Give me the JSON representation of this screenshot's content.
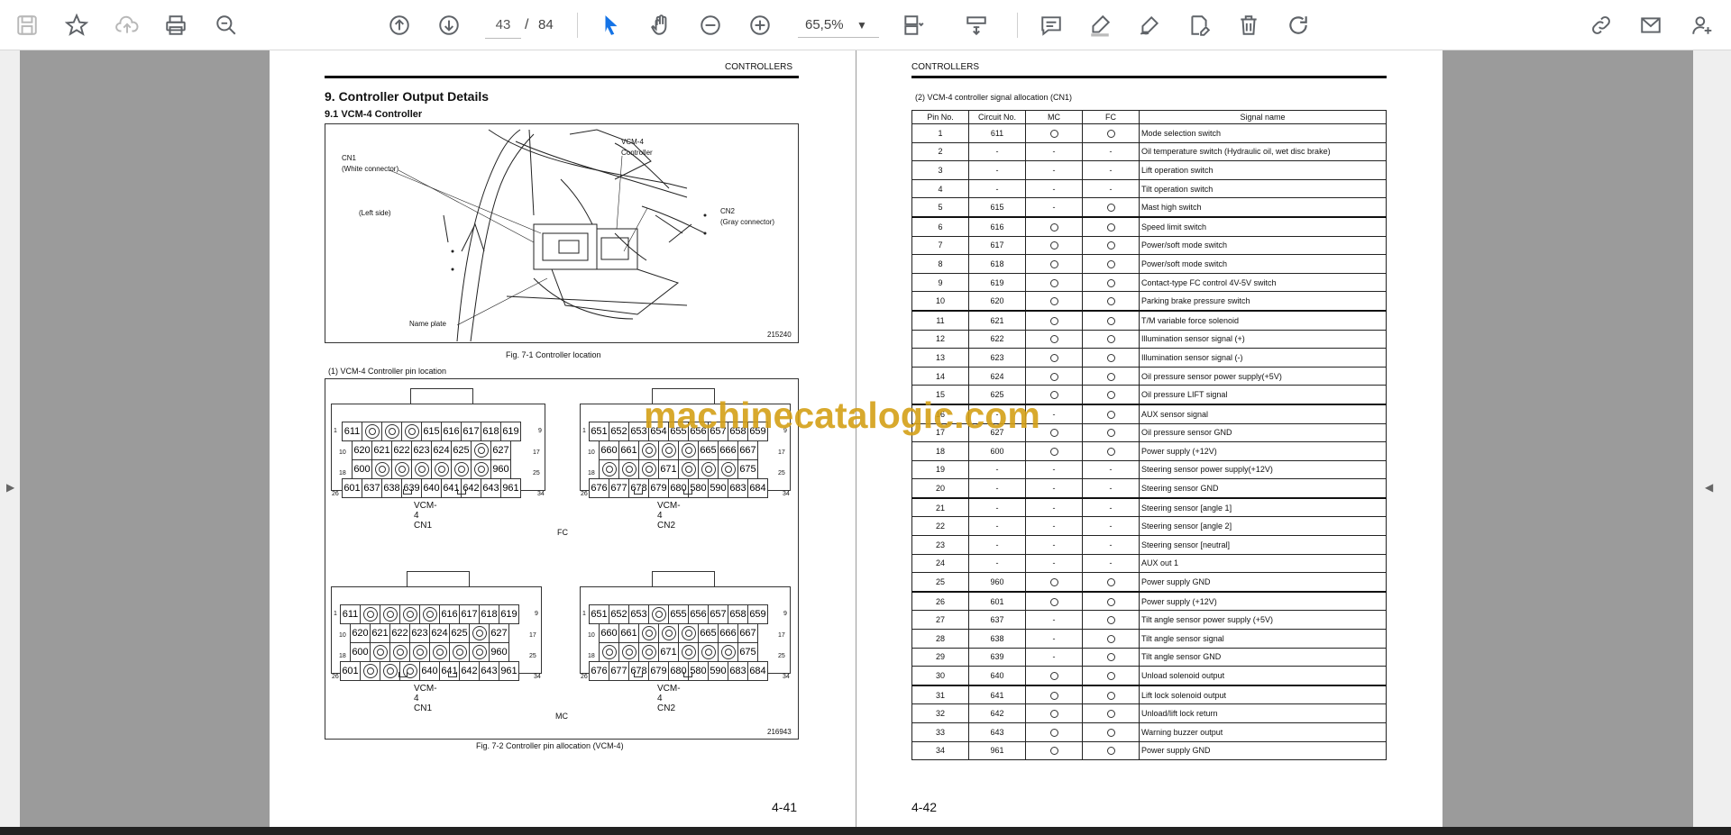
{
  "toolbar": {
    "icons": [
      "save-icon",
      "star-icon",
      "upload-icon",
      "print-icon",
      "zoom-search-icon",
      "page-up-icon",
      "page-down-icon",
      "select-icon",
      "hand-icon",
      "zoom-out-icon",
      "zoom-in-icon",
      "fit-page-icon",
      "scroll-mode-icon",
      "comment-icon",
      "highlight-icon",
      "sign-icon",
      "edit-pdf-icon",
      "delete-icon",
      "rotate-icon",
      "share-link-icon",
      "mail-icon",
      "add-user-icon"
    ],
    "current_page": "43",
    "page_sep": "/",
    "total_pages": "84",
    "zoom": "65,5%"
  },
  "left_page": {
    "header": "CONTROLLERS",
    "section_title": "9.  Controller Output Details",
    "subsection_title": "9.1    VCM-4 Controller",
    "fig1": {
      "labels": {
        "cn1": "CN1",
        "cn1_sub": "(White connector)",
        "vcm": "VCM-4",
        "vcm_sub": "Controller",
        "left_side": "(Left side)",
        "cn2": "CN2",
        "cn2_sub": "(Gray connector)",
        "name_plate": "Name plate",
        "code": "215240"
      },
      "caption": "Fig. 7-1  Controller location"
    },
    "pin_title": "(1)  VCM-4 Controller pin location",
    "fc_label": "FC",
    "mc_label": "MC",
    "fig2_code": "216943",
    "fig2_caption": "Fig. 7-2  Controller pin allocation (VCM-4)",
    "row_labels_cn1": [
      "1",
      "9",
      "10",
      "17",
      "18",
      "25",
      "26",
      "34"
    ],
    "row_labels_cn2": [
      "1",
      "9",
      "10",
      "17",
      "18",
      "25",
      "26",
      "34"
    ],
    "connectors": {
      "fc_cn1": {
        "label": "VCM-4 CN1",
        "rows": [
          [
            "611",
            "o",
            "o",
            "o",
            "615",
            "616",
            "617",
            "618",
            "619"
          ],
          [
            "620",
            "621",
            "622",
            "623",
            "624",
            "625",
            "o",
            "627"
          ],
          [
            "600",
            "o",
            "o",
            "o",
            "o",
            "o",
            "o",
            "960"
          ],
          [
            "601",
            "637",
            "638",
            "639",
            "640",
            "641",
            "642",
            "643",
            "961"
          ]
        ]
      },
      "fc_cn2": {
        "label": "VCM-4 CN2",
        "rows": [
          [
            "651",
            "652",
            "653",
            "654",
            "655",
            "656",
            "657",
            "658",
            "659"
          ],
          [
            "660",
            "661",
            "o",
            "o",
            "o",
            "665",
            "666",
            "667"
          ],
          [
            "o",
            "o",
            "o",
            "671",
            "o",
            "o",
            "o",
            "675"
          ],
          [
            "676",
            "677",
            "678",
            "679",
            "680",
            "580",
            "590",
            "683",
            "684"
          ]
        ]
      },
      "mc_cn1": {
        "label": "VCM-4 CN1",
        "rows": [
          [
            "611",
            "o",
            "o",
            "o",
            "o",
            "616",
            "617",
            "618",
            "619"
          ],
          [
            "620",
            "621",
            "622",
            "623",
            "624",
            "625",
            "o",
            "627"
          ],
          [
            "600",
            "o",
            "o",
            "o",
            "o",
            "o",
            "o",
            "960"
          ],
          [
            "601",
            "o",
            "o",
            "o",
            "640",
            "641",
            "642",
            "643",
            "961"
          ]
        ]
      },
      "mc_cn2": {
        "label": "VCM-4 CN2",
        "rows": [
          [
            "651",
            "652",
            "653",
            "o",
            "655",
            "656",
            "657",
            "658",
            "659"
          ],
          [
            "660",
            "661",
            "o",
            "o",
            "o",
            "665",
            "666",
            "667"
          ],
          [
            "o",
            "o",
            "o",
            "671",
            "o",
            "o",
            "o",
            "675"
          ],
          [
            "676",
            "677",
            "678",
            "679",
            "680",
            "580",
            "590",
            "683",
            "684"
          ]
        ]
      }
    },
    "page_number": "4-41"
  },
  "right_page": {
    "header": "CONTROLLERS",
    "table_title": "(2)  VCM-4 controller signal allocation (CN1)",
    "columns": [
      "Pin No.",
      "Circuit No.",
      "MC",
      "FC",
      "Signal name"
    ],
    "rows": [
      [
        "1",
        "611",
        "o",
        "o",
        "Mode selection switch"
      ],
      [
        "2",
        "-",
        "-",
        "-",
        "Oil temperature switch (Hydraulic oil, wet disc brake)"
      ],
      [
        "3",
        "-",
        "-",
        "-",
        "Lift operation switch"
      ],
      [
        "4",
        "-",
        "-",
        "-",
        "Tilt operation switch"
      ],
      [
        "5",
        "615",
        "-",
        "o",
        "Mast high switch"
      ],
      [
        "6",
        "616",
        "o",
        "o",
        "Speed limit switch"
      ],
      [
        "7",
        "617",
        "o",
        "o",
        "Power/soft mode switch"
      ],
      [
        "8",
        "618",
        "o",
        "o",
        "Power/soft mode switch"
      ],
      [
        "9",
        "619",
        "o",
        "o",
        "Contact-type FC control 4V-5V switch"
      ],
      [
        "10",
        "620",
        "o",
        "o",
        "Parking brake pressure switch"
      ],
      [
        "11",
        "621",
        "o",
        "o",
        "T/M variable force solenoid"
      ],
      [
        "12",
        "622",
        "o",
        "o",
        "Illumination sensor signal (+)"
      ],
      [
        "13",
        "623",
        "o",
        "o",
        "Illumination sensor signal (-)"
      ],
      [
        "14",
        "624",
        "o",
        "o",
        "Oil pressure sensor power supply(+5V)"
      ],
      [
        "15",
        "625",
        "o",
        "o",
        "Oil pressure LIFT signal"
      ],
      [
        "16",
        "-",
        "-",
        "o",
        "AUX sensor signal"
      ],
      [
        "17",
        "627",
        "o",
        "o",
        "Oil pressure sensor GND"
      ],
      [
        "18",
        "600",
        "o",
        "o",
        "Power supply (+12V)"
      ],
      [
        "19",
        "-",
        "-",
        "-",
        "Steering sensor power supply(+12V)"
      ],
      [
        "20",
        "-",
        "-",
        "-",
        "Steering sensor GND"
      ],
      [
        "21",
        "-",
        "-",
        "-",
        "Steering sensor [angle 1]"
      ],
      [
        "22",
        "-",
        "-",
        "-",
        "Steering sensor [angle 2]"
      ],
      [
        "23",
        "-",
        "-",
        "-",
        "Steering sensor [neutral]"
      ],
      [
        "24",
        "-",
        "-",
        "-",
        "AUX out 1"
      ],
      [
        "25",
        "960",
        "o",
        "o",
        "Power supply GND"
      ],
      [
        "26",
        "601",
        "o",
        "o",
        "Power supply (+12V)"
      ],
      [
        "27",
        "637",
        "-",
        "o",
        "Tilt angle sensor power supply (+5V)"
      ],
      [
        "28",
        "638",
        "-",
        "o",
        "Tilt angle sensor signal"
      ],
      [
        "29",
        "639",
        "-",
        "o",
        "Tilt angle sensor GND"
      ],
      [
        "30",
        "640",
        "o",
        "o",
        "Unload solenoid output"
      ],
      [
        "31",
        "641",
        "o",
        "o",
        "Lift lock solenoid output"
      ],
      [
        "32",
        "642",
        "o",
        "o",
        "Unload/lift lock return"
      ],
      [
        "33",
        "643",
        "o",
        "o",
        "Warning buzzer output"
      ],
      [
        "34",
        "961",
        "o",
        "o",
        "Power supply GND"
      ]
    ],
    "page_number": "4-42"
  },
  "watermark": "machinecatalogic.com"
}
